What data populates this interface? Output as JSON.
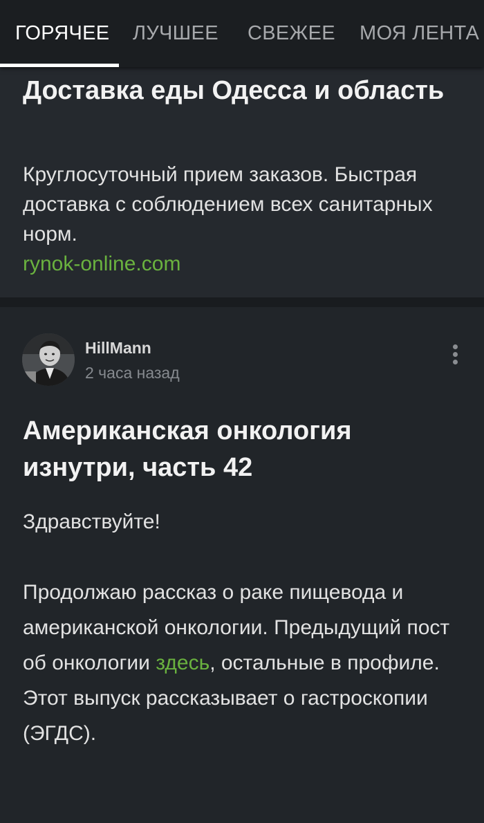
{
  "tabs": [
    {
      "label": "ГОРЯЧЕЕ",
      "active": true
    },
    {
      "label": "ЛУЧШЕЕ",
      "active": false
    },
    {
      "label": "СВЕЖЕЕ",
      "active": false
    },
    {
      "label": "МОЯ ЛЕНТА",
      "active": false
    }
  ],
  "ad": {
    "title": "Доставка еды Одесса и область",
    "text": "Круглосуточный прием заказов. Быстрая доставка с соблюдением всех санитарных норм.",
    "link": "rynok-online.com"
  },
  "post": {
    "author": "HillMann",
    "time": "2 часа назад",
    "title": "Американская онкология изнутри, часть 42",
    "body": {
      "greeting": "Здравствуйте!",
      "line1": "Продолжаю рассказ о раке пищевода и американской онкологии. Предыдущий пост об онкологии",
      "link_text": "здесь",
      "line2": ", остальные в профиле. Этот выпуск рассказывает о гастроскопии (ЭГДС)."
    }
  },
  "colors": {
    "background": "#212529",
    "header_bg": "#1b1e21",
    "accent_link": "#6ab23f",
    "active_tab": "#ffffff",
    "inactive_tab": "#a7a9ac"
  },
  "icons": {
    "more": "vertical-dots-icon",
    "avatar": "user-avatar-photo"
  }
}
